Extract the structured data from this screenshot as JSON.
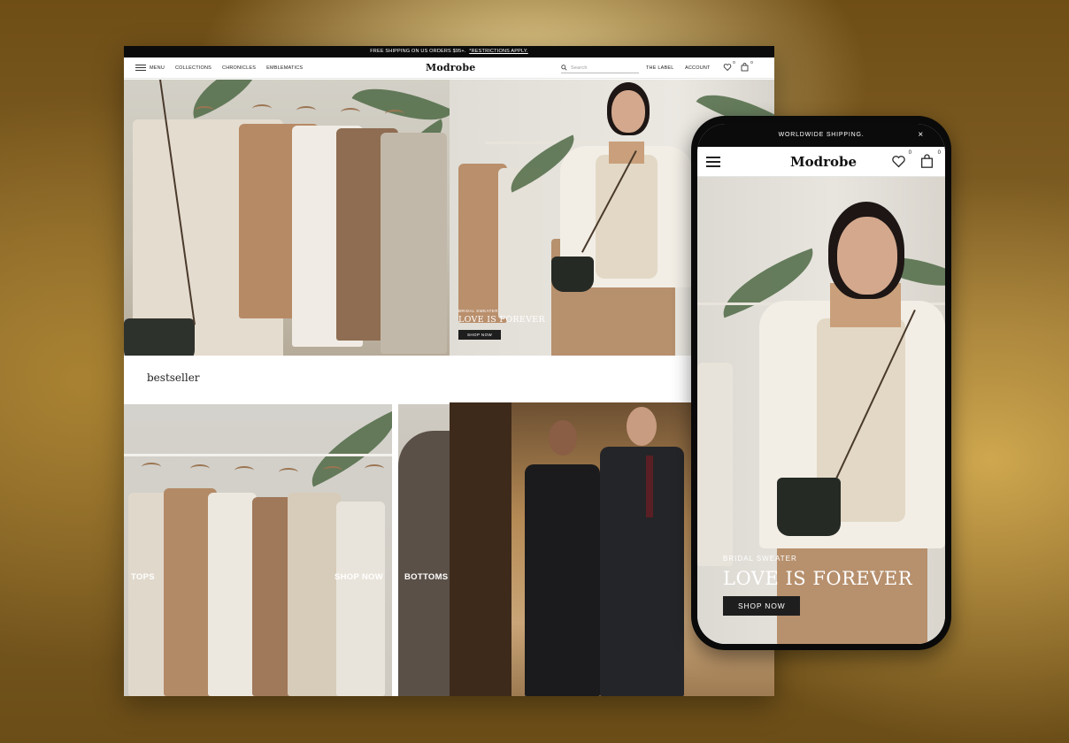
{
  "desktop": {
    "announcement": {
      "text": "FREE SHIPPING ON US ORDERS $95+.",
      "link": "*RESTRICTIONS APPLY."
    },
    "nav": {
      "menu_label": "MENU",
      "links": [
        "COLLECTIONS",
        "CHRONICLES",
        "EMBLEMATICS"
      ],
      "logo": "Modrobe",
      "search_placeholder": "Search",
      "the_label": "THE LABEL",
      "account": "ACCOUNT",
      "wishlist_count": "0",
      "cart_count": "0"
    },
    "hero": {
      "eyebrow": "BRIDAL SWEATER",
      "title": "LOVE IS FOREVER",
      "button": "SHOP NOW"
    },
    "section_title": "bestseller",
    "tiles": [
      {
        "label": "TOPS",
        "cta": "SHOP NOW"
      },
      {
        "label": "BOTTOMS"
      }
    ]
  },
  "phone": {
    "announcement": "WORLDWIDE SHIPPING.",
    "close_glyph": "×",
    "logo": "Modrobe",
    "wishlist_count": "0",
    "cart_count": "0",
    "hero": {
      "eyebrow": "BRIDAL SWEATER",
      "title": "LOVE IS FOREVER",
      "button": "SHOP NOW"
    }
  },
  "icons": [
    "menu-icon",
    "search-icon",
    "heart-icon",
    "bag-icon",
    "close-icon"
  ]
}
